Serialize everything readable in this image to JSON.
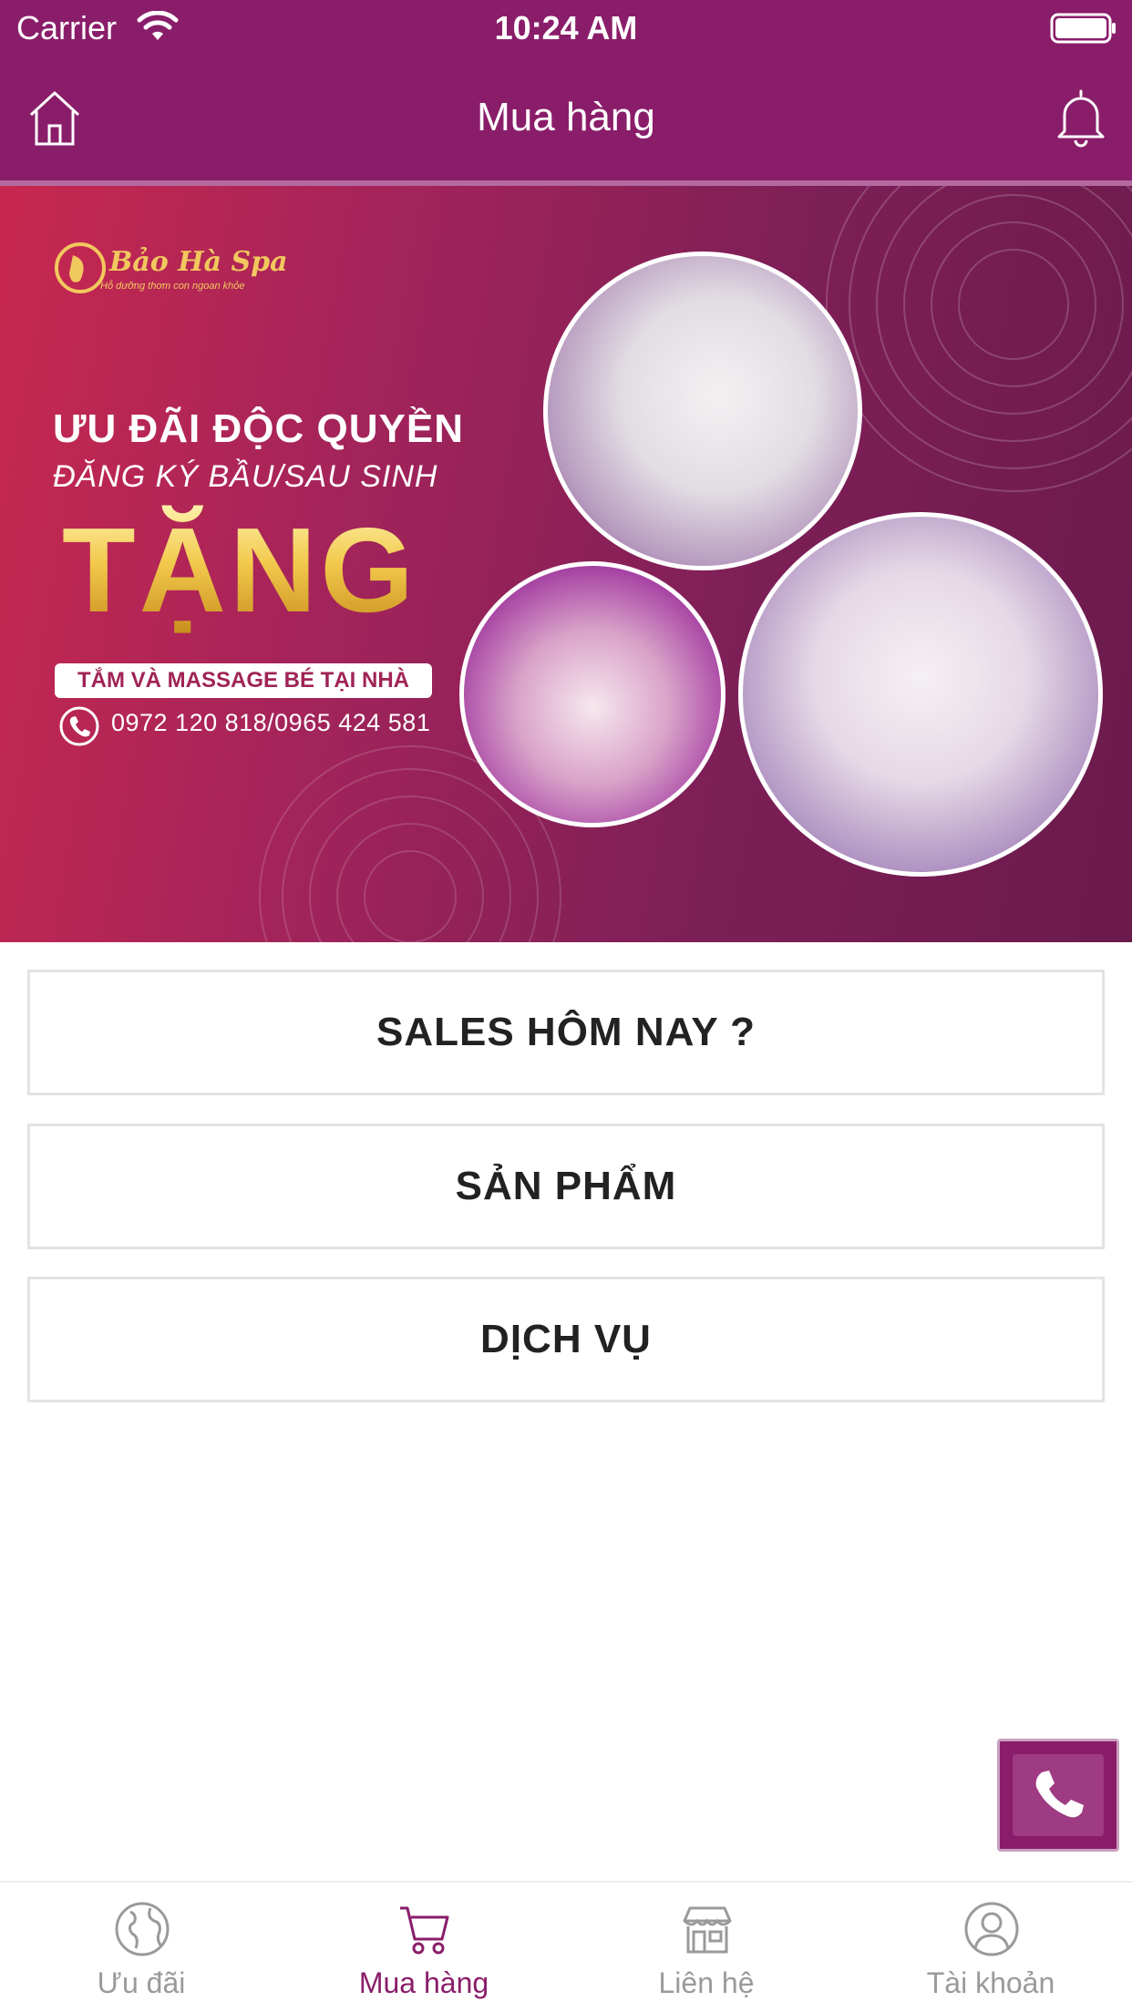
{
  "status_bar": {
    "carrier": "Carrier",
    "time": "10:24 AM"
  },
  "header": {
    "title": "Mua hàng"
  },
  "banner": {
    "logo": "Bảo Hà Spa",
    "logo_tagline": "Hỗ dưỡng thơm con ngoan khỏe",
    "offer_line1": "ƯU ĐÃI ĐỘC QUYỀN",
    "offer_line2": "ĐĂNG KÝ BẦU/SAU SINH",
    "gift": "TẶNG",
    "gift_detail": "TẮM VÀ MASSAGE BÉ TẠI NHÀ",
    "phones": "0972 120 818/0965 424 581"
  },
  "menu": [
    {
      "label": "SALES HÔM NAY ?"
    },
    {
      "label": "SẢN PHẨM"
    },
    {
      "label": "DỊCH VỤ"
    }
  ],
  "tabs": [
    {
      "label": "Ưu đãi",
      "icon": "globe-icon"
    },
    {
      "label": "Mua hàng",
      "icon": "cart-icon",
      "active": true
    },
    {
      "label": "Liên hệ",
      "icon": "store-icon"
    },
    {
      "label": "Tài khoản",
      "icon": "user-icon"
    }
  ],
  "colors": {
    "primary": "#8a1d6a",
    "inactive": "#9a9a9a",
    "gold": "#f2c94c"
  }
}
